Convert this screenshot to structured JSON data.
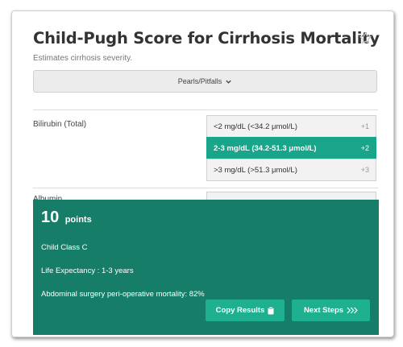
{
  "calculator": {
    "title": "Child-Pugh Score for Cirrhosis Mortality",
    "subtitle": "Estimates cirrhosis severity.",
    "pearls_label": "Pearls/Pitfalls"
  },
  "bilirubin": {
    "label": "Bilirubin (Total)",
    "options": [
      {
        "label": "<2 mg/dL (<34.2 μmol/L)",
        "points": "+1"
      },
      {
        "label": "2-3 mg/dL (34.2-51.3 μmol/L)",
        "points": "+2"
      },
      {
        "label": ">3 mg/dL (>51.3 μmol/L)",
        "points": "+3"
      }
    ],
    "selected_index": 1
  },
  "next_row": {
    "label": "Albumin"
  },
  "result": {
    "score": "10",
    "score_unit": "points",
    "class_text": "Child Class C",
    "life_expectancy": "Life Expectancy : 1-3 years",
    "surgery_mortality": "Abdominal surgery peri-operative mortality: 82%",
    "copy_button": "Copy Results",
    "next_button": "Next Steps"
  },
  "colors": {
    "selected_option": "#18a589",
    "result_panel": "#167e68",
    "result_button": "#1fb08f"
  }
}
